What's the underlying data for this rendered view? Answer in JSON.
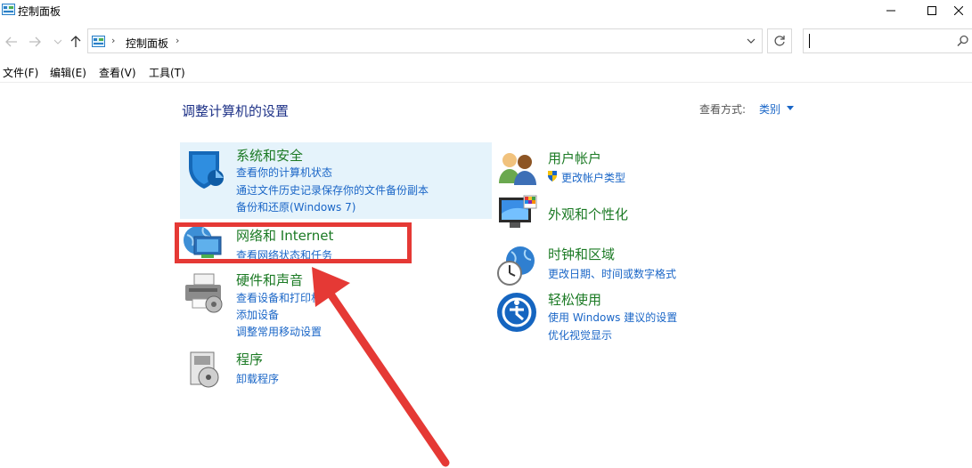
{
  "window": {
    "title": "控制面板"
  },
  "address": {
    "segments": [
      "控制面板"
    ],
    "search_placeholder": ""
  },
  "menu": [
    "文件(F)",
    "编辑(E)",
    "查看(V)",
    "工具(T)"
  ],
  "page": {
    "heading": "调整计算机的设置",
    "view_by_label": "查看方式:",
    "view_by_value": "类别"
  },
  "categories_left": [
    {
      "title": "系统和安全",
      "links": [
        "查看你的计算机状态",
        "通过文件历史记录保存你的文件备份副本",
        "备份和还原(Windows 7)"
      ]
    },
    {
      "title": "网络和 Internet",
      "links": [
        "查看网络状态和任务"
      ]
    },
    {
      "title": "硬件和声音",
      "links": [
        "查看设备和打印机",
        "添加设备",
        "调整常用移动设置"
      ]
    },
    {
      "title": "程序",
      "links": [
        "卸载程序"
      ]
    }
  ],
  "categories_right": [
    {
      "title": "用户帐户",
      "links": [
        "更改帐户类型"
      ]
    },
    {
      "title": "外观和个性化",
      "links": []
    },
    {
      "title": "时钟和区域",
      "links": [
        "更改日期、时间或数字格式"
      ]
    },
    {
      "title": "轻松使用",
      "links": [
        "使用 Windows 建议的设置",
        "优化视觉显示"
      ]
    }
  ],
  "colors": {
    "accent_link": "#1a66c7",
    "category_title": "#1b7a24",
    "heading": "#1e3287",
    "annotation": "#e53935",
    "hover_bg": "#e5f3fb"
  },
  "icons": [
    "control-panel-icon",
    "shield-icon",
    "network-icon",
    "printer-icon",
    "programs-icon",
    "users-icon",
    "monitor-icon",
    "clock-globe-icon",
    "ease-of-access-icon"
  ]
}
